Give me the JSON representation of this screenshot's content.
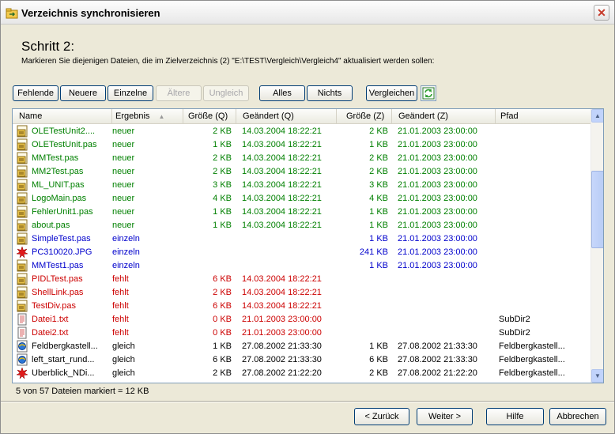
{
  "window": {
    "title": "Verzeichnis synchronisieren",
    "close_glyph": "✕"
  },
  "header": {
    "step_title": "Schritt 2:",
    "step_desc": "Markieren Sie diejenigen Dateien, die im Zielverzeichnis (2) \"E:\\TEST\\Vergleich\\Vergleich4\" aktualisiert werden sollen:"
  },
  "toolbar": {
    "fehlende": "Fehlende",
    "neuere": "Neuere",
    "einzelne": "Einzelne",
    "aeltere": "Ältere",
    "ungleich": "Ungleich",
    "alles": "Alles",
    "nichts": "Nichts",
    "vergleichen": "Vergleichen",
    "refresh_icon": "refresh-icon"
  },
  "columns": {
    "name": "Name",
    "ergebnis": "Ergebnis",
    "groesse_q": "Größe (Q)",
    "geaendert_q": "Geändert (Q)",
    "groesse_z": "Größe (Z)",
    "geaendert_z": "Geändert (Z)",
    "pfad": "Pfad"
  },
  "colors": {
    "neuer": "#008000",
    "einzeln": "#0000cc",
    "fehlt": "#cc0000",
    "gleich": "#000000"
  },
  "rows": [
    {
      "icon": "pas-file-icon",
      "name": "OLETestUnit2....",
      "ergebnis": "neuer",
      "gq": "2 KB",
      "dq": "14.03.2004  18:22:21",
      "gz": "2 KB",
      "dz": "21.01.2003  23:00:00",
      "pfad": ""
    },
    {
      "icon": "pas-file-icon",
      "name": "OLETestUnit.pas",
      "ergebnis": "neuer",
      "gq": "1 KB",
      "dq": "14.03.2004  18:22:21",
      "gz": "1 KB",
      "dz": "21.01.2003  23:00:00",
      "pfad": ""
    },
    {
      "icon": "pas-file-icon",
      "name": "MMTest.pas",
      "ergebnis": "neuer",
      "gq": "2 KB",
      "dq": "14.03.2004  18:22:21",
      "gz": "2 KB",
      "dz": "21.01.2003  23:00:00",
      "pfad": ""
    },
    {
      "icon": "pas-file-icon",
      "name": "MM2Test.pas",
      "ergebnis": "neuer",
      "gq": "2 KB",
      "dq": "14.03.2004  18:22:21",
      "gz": "2 KB",
      "dz": "21.01.2003  23:00:00",
      "pfad": ""
    },
    {
      "icon": "pas-file-icon",
      "name": "ML_UNIT.pas",
      "ergebnis": "neuer",
      "gq": "3 KB",
      "dq": "14.03.2004  18:22:21",
      "gz": "3 KB",
      "dz": "21.01.2003  23:00:00",
      "pfad": ""
    },
    {
      "icon": "pas-file-icon",
      "name": "LogoMain.pas",
      "ergebnis": "neuer",
      "gq": "4 KB",
      "dq": "14.03.2004  18:22:21",
      "gz": "4 KB",
      "dz": "21.01.2003  23:00:00",
      "pfad": ""
    },
    {
      "icon": "pas-file-icon",
      "name": "FehlerUnit1.pas",
      "ergebnis": "neuer",
      "gq": "1 KB",
      "dq": "14.03.2004  18:22:21",
      "gz": "1 KB",
      "dz": "21.01.2003  23:00:00",
      "pfad": ""
    },
    {
      "icon": "pas-file-icon",
      "name": "about.pas",
      "ergebnis": "neuer",
      "gq": "1 KB",
      "dq": "14.03.2004  18:22:21",
      "gz": "1 KB",
      "dz": "21.01.2003  23:00:00",
      "pfad": ""
    },
    {
      "icon": "pas-file-icon",
      "name": "SimpleTest.pas",
      "ergebnis": "einzeln",
      "gq": "",
      "dq": "",
      "gz": "1 KB",
      "dz": "21.01.2003  23:00:00",
      "pfad": ""
    },
    {
      "icon": "jpg-file-icon",
      "name": "PC310020.JPG",
      "ergebnis": "einzeln",
      "gq": "",
      "dq": "",
      "gz": "241 KB",
      "dz": "21.01.2003  23:00:00",
      "pfad": ""
    },
    {
      "icon": "pas-file-icon",
      "name": "MMTest1.pas",
      "ergebnis": "einzeln",
      "gq": "",
      "dq": "",
      "gz": "1 KB",
      "dz": "21.01.2003  23:00:00",
      "pfad": ""
    },
    {
      "icon": "pas-file-icon",
      "name": "PIDLTest.pas",
      "ergebnis": "fehlt",
      "gq": "6 KB",
      "dq": "14.03.2004  18:22:21",
      "gz": "",
      "dz": "",
      "pfad": ""
    },
    {
      "icon": "pas-file-icon",
      "name": "ShellLink.pas",
      "ergebnis": "fehlt",
      "gq": "2 KB",
      "dq": "14.03.2004  18:22:21",
      "gz": "",
      "dz": "",
      "pfad": ""
    },
    {
      "icon": "pas-file-icon",
      "name": "TestDiv.pas",
      "ergebnis": "fehlt",
      "gq": "6 KB",
      "dq": "14.03.2004  18:22:21",
      "gz": "",
      "dz": "",
      "pfad": ""
    },
    {
      "icon": "txt-file-icon",
      "name": "Datei1.txt",
      "ergebnis": "fehlt",
      "gq": "0 KB",
      "dq": "21.01.2003  23:00:00",
      "gz": "",
      "dz": "",
      "pfad": "SubDir2"
    },
    {
      "icon": "txt-file-icon",
      "name": "Datei2.txt",
      "ergebnis": "fehlt",
      "gq": "0 KB",
      "dq": "21.01.2003  23:00:00",
      "gz": "",
      "dz": "",
      "pfad": "SubDir2"
    },
    {
      "icon": "html-file-icon",
      "name": "Feldbergkastell...",
      "ergebnis": "gleich",
      "gq": "1 KB",
      "dq": "27.08.2002  21:33:30",
      "gz": "1 KB",
      "dz": "27.08.2002  21:33:30",
      "pfad": "Feldbergkastell..."
    },
    {
      "icon": "html-file-icon",
      "name": "left_start_rund...",
      "ergebnis": "gleich",
      "gq": "6 KB",
      "dq": "27.08.2002  21:33:30",
      "gz": "6 KB",
      "dz": "27.08.2002  21:33:30",
      "pfad": "Feldbergkastell..."
    },
    {
      "icon": "jpg-file-icon",
      "name": "Uberblick_NDi...",
      "ergebnis": "gleich",
      "gq": "2 KB",
      "dq": "27.08.2002  21:22:20",
      "gz": "2 KB",
      "dz": "27.08.2002  21:22:20",
      "pfad": "Feldbergkastell..."
    }
  ],
  "status": "5 von 57 Dateien markiert = 12 KB",
  "footer": {
    "zurueck": "< Zurück",
    "weiter": "Weiter >",
    "hilfe": "Hilfe",
    "abbrechen": "Abbrechen"
  }
}
